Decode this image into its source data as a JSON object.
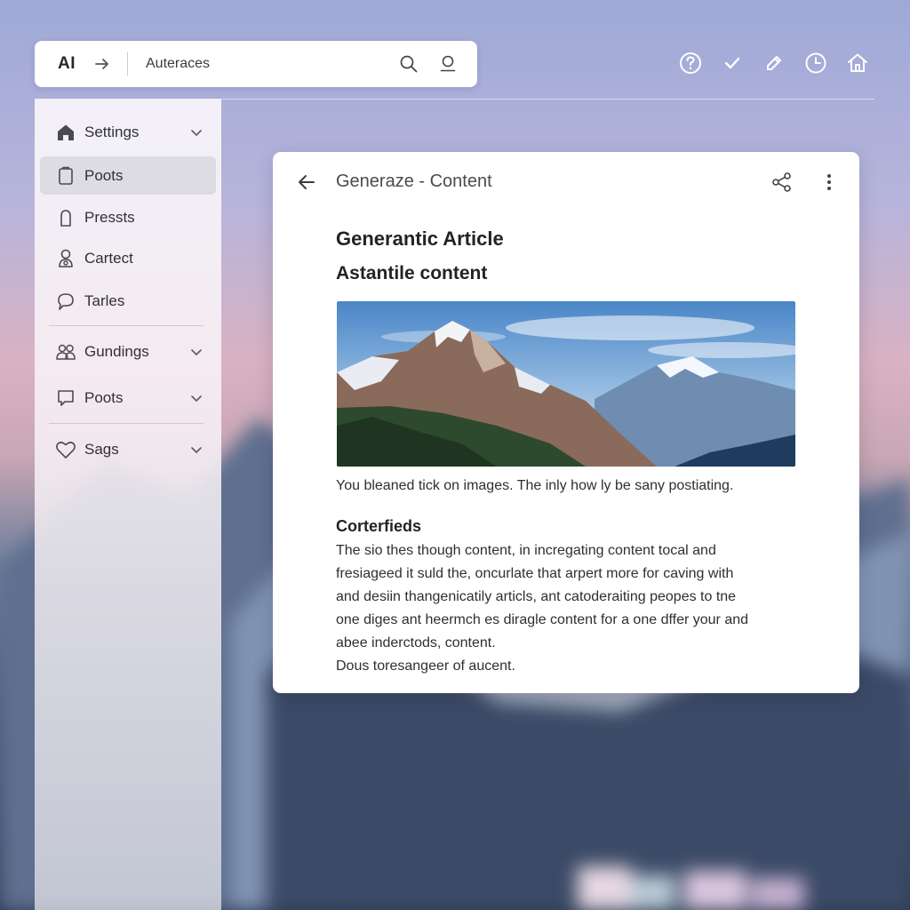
{
  "header": {
    "brand": "AI",
    "search_value": "Auteraces"
  },
  "sidebar": {
    "items": [
      {
        "label": "Settings",
        "icon": "home-icon",
        "chevron": true
      },
      {
        "label": "Poots",
        "icon": "clipboard-icon",
        "active": true
      },
      {
        "label": "Pressts",
        "icon": "bag-icon"
      },
      {
        "label": "Cartect",
        "icon": "contact-icon"
      },
      {
        "label": "Tarles",
        "icon": "chat-icon"
      },
      {
        "label": "Gundings",
        "icon": "group-icon",
        "chevron": true
      },
      {
        "label": "Poots",
        "icon": "message-icon",
        "chevron": true
      },
      {
        "label": "Sags",
        "icon": "heart-icon",
        "chevron": true
      }
    ]
  },
  "toolbar": {
    "icons": [
      "help-icon",
      "check-icon",
      "edit-icon",
      "clock-icon",
      "house-icon"
    ]
  },
  "card": {
    "title": "Generaze - Content",
    "article_title": "Generantic Article",
    "article_subtitle": "Astantile content",
    "image_caption": "You bleaned tick on images. The inly how ly be sany postiating.",
    "section_heading": "Corterfieds",
    "paragraph_lines": [
      "The sio thes though content, in incregating content tocal and",
      "fresiageed it suld the, oncurlate that arpert more for caving with",
      "and desiin thangenicatily articls, ant catoderaiting peopes to tne",
      "one diges ant heermch es diragle content for a one dffer your and",
      "abee inderctods, content.",
      "Dous toresangeer of aucent."
    ]
  },
  "colors": {
    "sidebar_bg": "#f6f1f5",
    "card_bg": "#ffffff",
    "active_item_bg": "#d7d7de",
    "text": "#2a2a2e"
  }
}
